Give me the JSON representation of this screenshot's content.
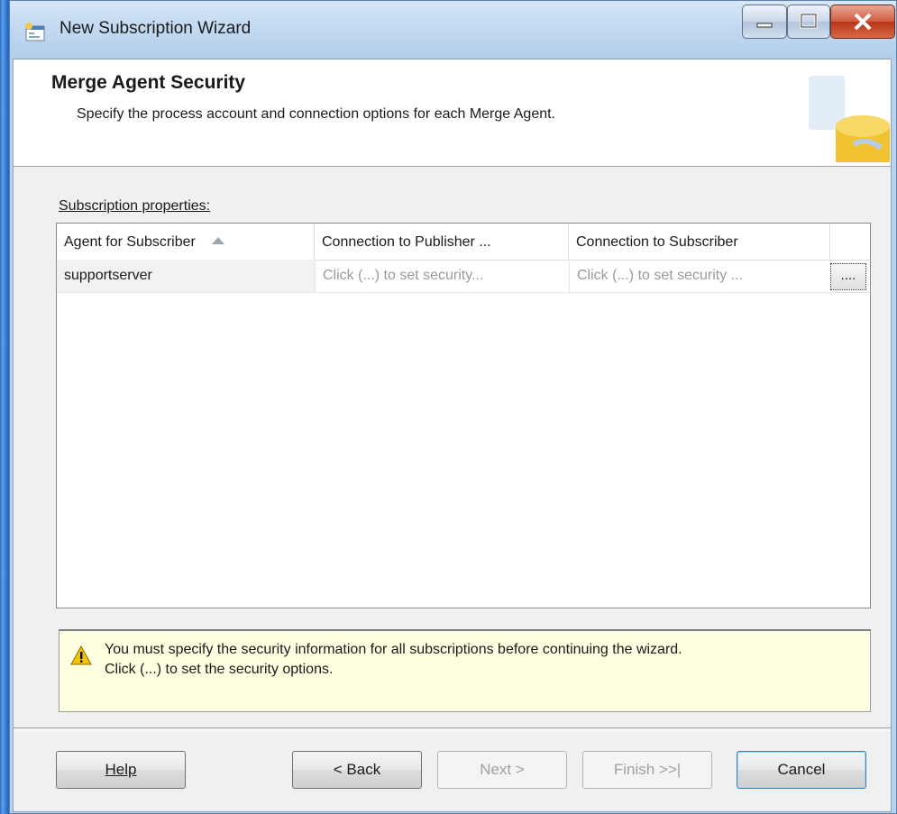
{
  "window": {
    "title": "New Subscription Wizard"
  },
  "header": {
    "title": "Merge Agent Security",
    "subtitle": "Specify the process account and connection options for each Merge Agent."
  },
  "properties": {
    "label": "Subscription properties:",
    "columns": [
      "Agent for Subscriber",
      "Connection to Publisher ...",
      "Connection to Subscriber"
    ],
    "rows": [
      {
        "agent": "supportserver",
        "publisher_connection": "Click (...) to set security...",
        "subscriber_connection": "Click (...) to set security ..."
      }
    ],
    "ellipsis_label": "...."
  },
  "warning": {
    "line1": "You must specify the security information for all subscriptions before continuing the wizard.",
    "line2": "Click (...) to set the security options."
  },
  "buttons": {
    "help": "Help",
    "back": "< Back",
    "next": "Next >",
    "finish": "Finish >>|",
    "cancel": "Cancel"
  }
}
